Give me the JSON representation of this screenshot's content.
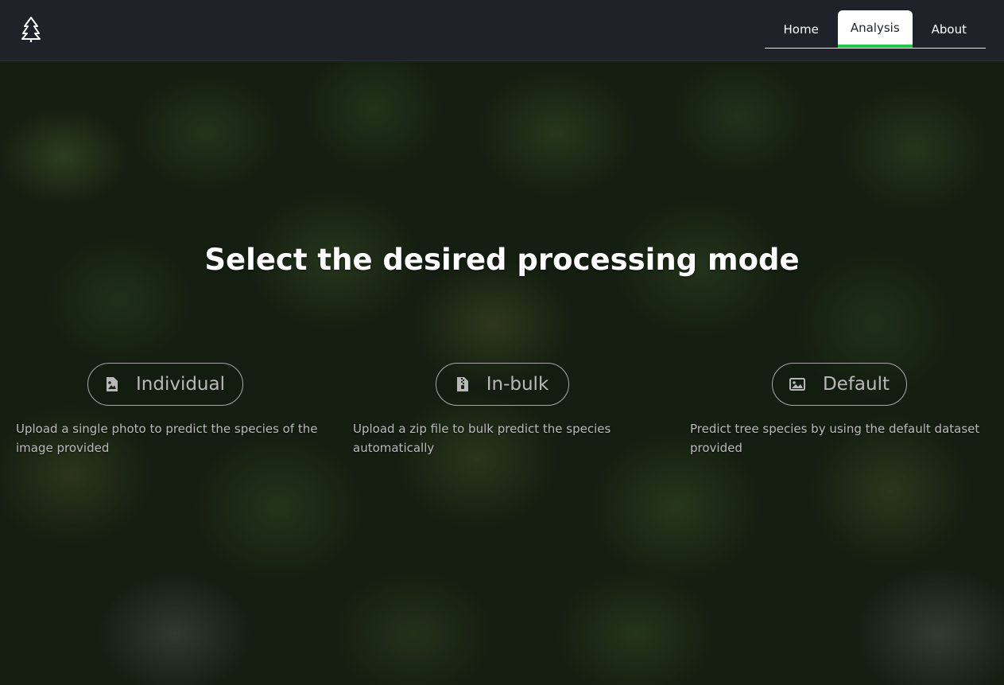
{
  "app": {
    "logo_icon": "pine-tree-icon"
  },
  "nav": {
    "items": [
      {
        "label": "Home",
        "active": false
      },
      {
        "label": "Analysis",
        "active": true
      },
      {
        "label": "About",
        "active": false
      }
    ],
    "active_color": "#1fc64a"
  },
  "main": {
    "title": "Select the desired processing mode",
    "modes": [
      {
        "label": "Individual",
        "icon": "image-file-icon",
        "description": "Upload a single photo to predict the species of the image provided"
      },
      {
        "label": "In-bulk",
        "icon": "zip-file-icon",
        "description": "Upload a zip file to bulk predict the species automatically"
      },
      {
        "label": "Default",
        "icon": "image-icon",
        "description": "Predict tree species by using the default dataset provided"
      }
    ]
  }
}
